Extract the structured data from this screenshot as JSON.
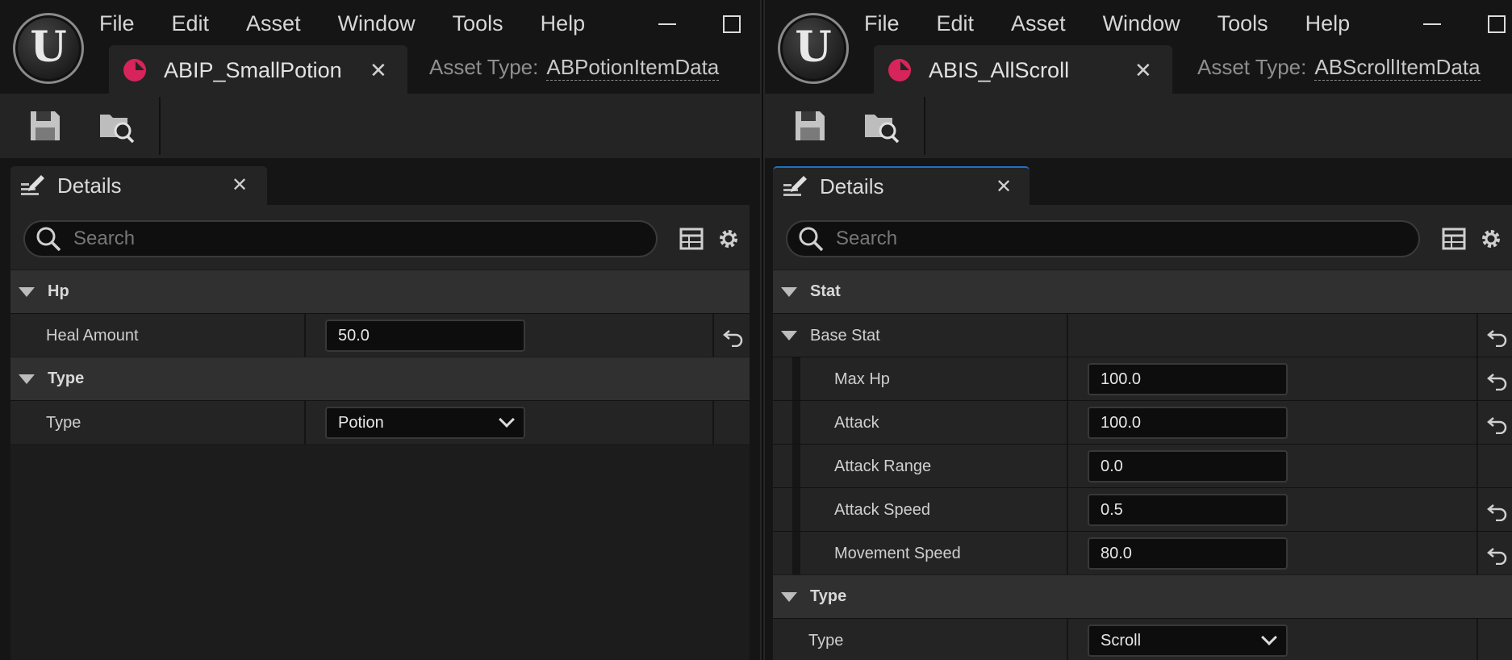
{
  "menu": [
    "File",
    "Edit",
    "Asset",
    "Window",
    "Tools",
    "Help"
  ],
  "logo_letter": "U",
  "left": {
    "tab_title": "ABIP_SmallPotion",
    "asset_type_label": "Asset Type:",
    "asset_type_value": "ABPotionItemData",
    "details_title": "Details",
    "search_placeholder": "Search",
    "categories": {
      "hp": "Hp",
      "type": "Type"
    },
    "props": {
      "heal_amount": {
        "name": "Heal Amount",
        "value": "50.0"
      },
      "type": {
        "name": "Type",
        "value": "Potion"
      }
    }
  },
  "right": {
    "tab_title": "ABIS_AllScroll",
    "asset_type_label": "Asset Type:",
    "asset_type_value": "ABScrollItemData",
    "details_title": "Details",
    "search_placeholder": "Search",
    "categories": {
      "stat": "Stat",
      "type": "Type"
    },
    "base_stat_label": "Base Stat",
    "props": {
      "max_hp": {
        "name": "Max Hp",
        "value": "100.0"
      },
      "attack": {
        "name": "Attack",
        "value": "100.0"
      },
      "attack_range": {
        "name": "Attack Range",
        "value": "0.0"
      },
      "attack_speed": {
        "name": "Attack Speed",
        "value": "0.5"
      },
      "movement_speed": {
        "name": "Movement Speed",
        "value": "80.0"
      },
      "type": {
        "name": "Type",
        "value": "Scroll"
      }
    }
  },
  "colors": {
    "asset_accent": "#d7245a",
    "active_tab_accent": "#1f6fc4"
  },
  "icons": [
    "unreal-logo-icon",
    "animation-asset-icon",
    "close-icon",
    "save-icon",
    "browse-asset-icon",
    "details-pencil-icon",
    "search-icon",
    "table-view-icon",
    "gear-icon",
    "collapse-arrow-icon",
    "reset-default-icon",
    "chevron-down-icon",
    "minimize-icon",
    "maximize-icon"
  ]
}
